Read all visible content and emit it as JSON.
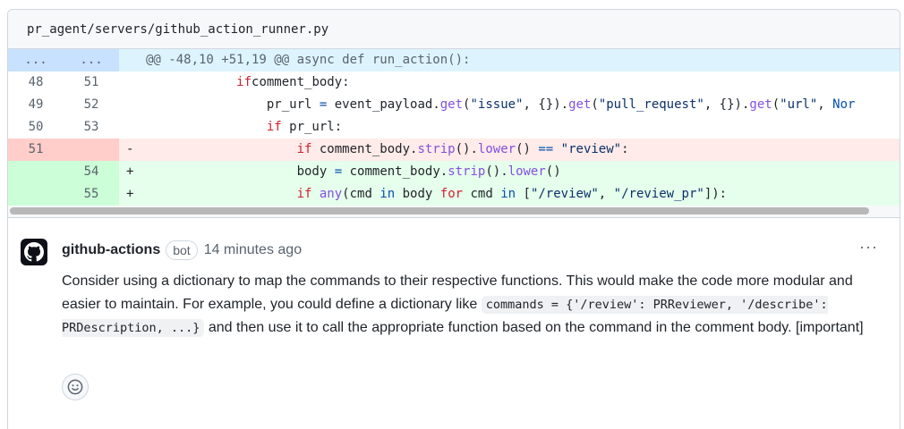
{
  "file": {
    "path": "pr_agent/servers/github_action_runner.py"
  },
  "diff": {
    "hunk": {
      "left": "...",
      "right": "...",
      "header": "@@ -48,10 +51,19 @@ async def run_action():"
    },
    "lines": [
      {
        "old": "48",
        "new": "51",
        "marker": "",
        "indent": "            ",
        "tokens": [
          [
            "kw",
            "if"
          ],
          [
            "",
            "comment_body:"
          ]
        ]
      },
      {
        "old": "49",
        "new": "52",
        "marker": "",
        "indent": "                ",
        "tokens": [
          [
            "",
            "pr_url "
          ],
          [
            "op",
            "="
          ],
          [
            "",
            " event_payload."
          ],
          [
            "fn",
            "get"
          ],
          [
            "",
            "("
          ],
          [
            "st",
            "\"issue\""
          ],
          [
            "",
            ", {})."
          ],
          [
            "fn",
            "get"
          ],
          [
            "",
            "("
          ],
          [
            "st",
            "\"pull_request\""
          ],
          [
            "",
            ", {})."
          ],
          [
            "fn",
            "get"
          ],
          [
            "",
            "("
          ],
          [
            "st",
            "\"url\""
          ],
          [
            "",
            ", "
          ],
          [
            "op",
            "Nor"
          ]
        ]
      },
      {
        "old": "50",
        "new": "53",
        "marker": "",
        "indent": "                ",
        "tokens": [
          [
            "kw",
            "if"
          ],
          [
            "",
            " pr_url:"
          ]
        ]
      },
      {
        "old": "51",
        "new": "",
        "marker": "-",
        "type": "del",
        "indent": "                    ",
        "tokens": [
          [
            "kw",
            "if"
          ],
          [
            "",
            " comment_body."
          ],
          [
            "fn",
            "strip"
          ],
          [
            "",
            "()."
          ],
          [
            "fn",
            "lower"
          ],
          [
            "",
            "() "
          ],
          [
            "op",
            "=="
          ],
          [
            "",
            " "
          ],
          [
            "st",
            "\"review\""
          ],
          [
            "",
            ":"
          ]
        ]
      },
      {
        "old": "",
        "new": "54",
        "marker": "+",
        "type": "add",
        "indent": "                    ",
        "tokens": [
          [
            "",
            "body "
          ],
          [
            "op",
            "="
          ],
          [
            "",
            " comment_body."
          ],
          [
            "fn",
            "strip"
          ],
          [
            "",
            "()."
          ],
          [
            "fn",
            "lower"
          ],
          [
            "",
            "()"
          ]
        ]
      },
      {
        "old": "",
        "new": "55",
        "marker": "+",
        "type": "add",
        "indent": "                    ",
        "tokens": [
          [
            "kw",
            "if"
          ],
          [
            "",
            " "
          ],
          [
            "fn",
            "any"
          ],
          [
            "",
            "(cmd "
          ],
          [
            "op",
            "in"
          ],
          [
            "",
            " body "
          ],
          [
            "kw",
            "for"
          ],
          [
            "",
            " cmd "
          ],
          [
            "op",
            "in"
          ],
          [
            "",
            " ["
          ],
          [
            "st",
            "\"/review\""
          ],
          [
            "",
            ", "
          ],
          [
            "st",
            "\"/review_pr\""
          ],
          [
            "",
            "]):"
          ]
        ]
      }
    ]
  },
  "comment": {
    "author": "github-actions",
    "badge": "bot",
    "time": "14 minutes ago",
    "more": "···",
    "text_1": "Consider using a dictionary to map the commands to their respective functions. This would make the code more modular and easier to maintain. For example, you could define a dictionary like ",
    "code_1": "commands = {'/review': PRReviewer, '/describe': PRDescription, ...}",
    "text_2": " and then use it to call the appropriate function based on the command in the comment body. [important]"
  }
}
